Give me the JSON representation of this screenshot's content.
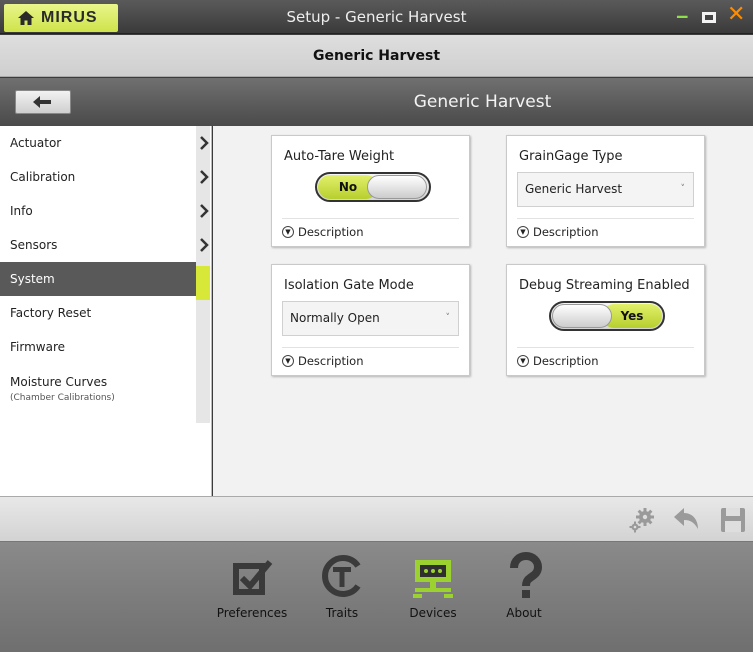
{
  "window": {
    "brand": "MIRUS",
    "title": "Setup - Generic Harvest",
    "min_glyph": "‒",
    "close_glyph": "✕"
  },
  "header": {
    "title": "Generic Harvest"
  },
  "subnav": {
    "title": "Generic Harvest"
  },
  "sidebar": {
    "items": [
      {
        "label": "Actuator",
        "has_chevron": true
      },
      {
        "label": "Calibration",
        "has_chevron": true
      },
      {
        "label": "Info",
        "has_chevron": true
      },
      {
        "label": "Sensors",
        "has_chevron": true
      },
      {
        "label": "System",
        "active": true
      },
      {
        "label": "Factory Reset"
      },
      {
        "label": "Firmware"
      },
      {
        "label": "Moisture Curves",
        "sublabel": "(Chamber Calibrations)"
      }
    ]
  },
  "cards": {
    "auto_tare": {
      "title": "Auto-Tare Weight",
      "toggle_label": "No",
      "toggle_state": "off",
      "desc": "Description"
    },
    "graingage": {
      "title": "GrainGage Type",
      "value": "Generic Harvest",
      "desc": "Description"
    },
    "isolation": {
      "title": "Isolation Gate Mode",
      "value": "Normally Open",
      "desc": "Description"
    },
    "debug": {
      "title": "Debug Streaming Enabled",
      "toggle_label": "Yes",
      "toggle_state": "on",
      "desc": "Description"
    }
  },
  "toolbar": {
    "icons": [
      "gears-icon",
      "undo-icon",
      "save-icon"
    ]
  },
  "footer": {
    "nav": [
      {
        "label": "Preferences",
        "icon": "checkbox-icon"
      },
      {
        "label": "Traits",
        "icon": "traits-icon"
      },
      {
        "label": "Devices",
        "icon": "device-icon",
        "active": true
      },
      {
        "label": "About",
        "icon": "question-icon"
      }
    ]
  },
  "colors": {
    "accent": "#cfe34a",
    "close": "#ff8c00",
    "minimize": "#8ee04a"
  }
}
